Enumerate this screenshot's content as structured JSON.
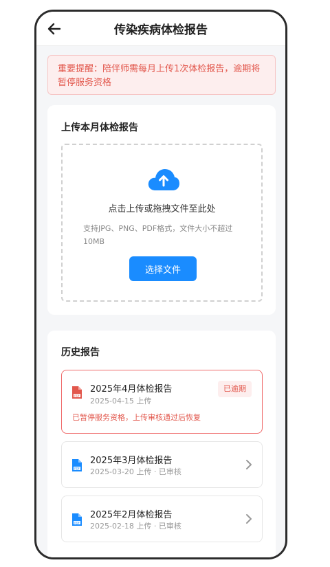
{
  "header": {
    "title": "传染疾病体检报告",
    "back_icon": "arrow-left-icon"
  },
  "alert": {
    "text": "重要提醒：陪伴师需每月上传1次体检报告，逾期将暂停服务资格"
  },
  "upload": {
    "title": "上传本月体检报告",
    "icon": "cloud-upload-icon",
    "drop_text": "点击上传或拖拽文件至此处",
    "hint": "支持JPG、PNG、PDF格式，文件大小不超过10MB",
    "button_label": "选择文件"
  },
  "history": {
    "title": "历史报告",
    "reports": [
      {
        "name": "2025年4月体检报告",
        "date": "2025-04-15 上传",
        "badge": "已逾期",
        "warning": "已暂停服务资格，上传审核通过后恢复",
        "icon_color": "#e2574c"
      },
      {
        "name": "2025年3月体检报告",
        "date": "2025-03-20 上传 · 已审核",
        "icon_color": "#1a8cff"
      },
      {
        "name": "2025年2月体检报告",
        "date": "2025-02-18 上传 · 已审核",
        "icon_color": "#1a8cff"
      }
    ]
  },
  "colors": {
    "accent": "#1a8cff",
    "danger": "#e2574c",
    "background": "#f5f6f8"
  }
}
